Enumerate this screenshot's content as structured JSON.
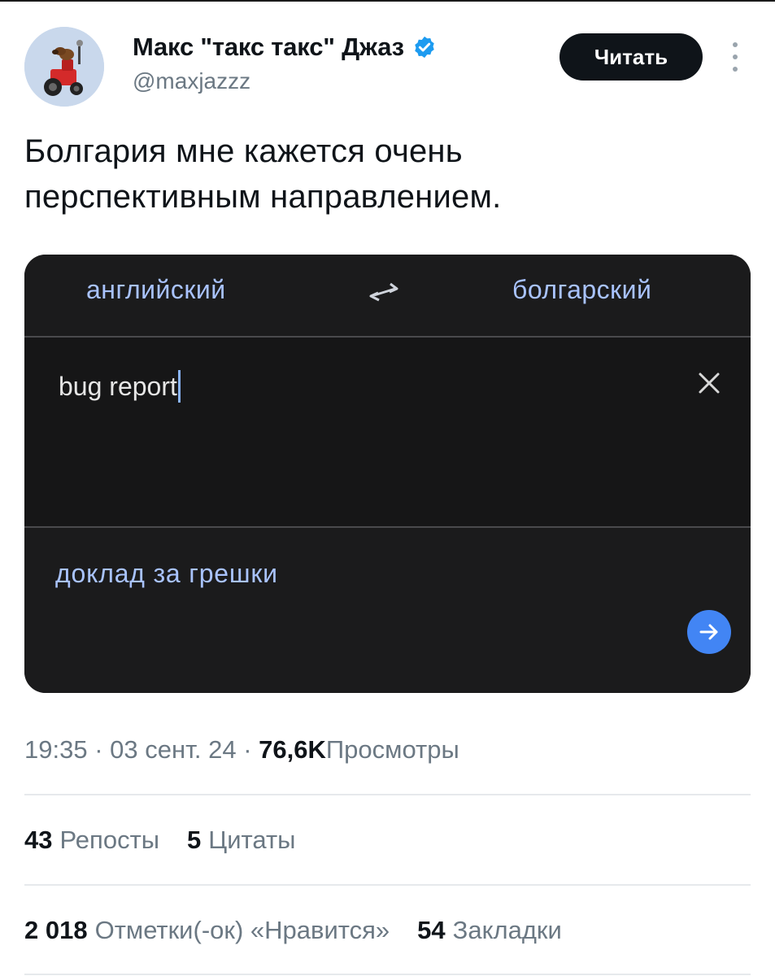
{
  "header": {
    "display_name": "Макс \"такс такс\" Джаз",
    "handle": "@maxjazzz",
    "follow_label": "Читать",
    "icons": {
      "verified": "verified-badge-icon",
      "more": "more-vertical-icon",
      "avatar": "avatar-dachshund-tractor"
    }
  },
  "tweet": {
    "text_line1": "Болгария мне кажется очень",
    "text_line2": "перспективным направлением."
  },
  "translator": {
    "source_language": "английский",
    "target_language": "болгарский",
    "source_text": "bug report",
    "translated_text": "доклад за грешки",
    "icons": {
      "swap": "swap-languages-icon",
      "clear": "close-icon",
      "go": "arrow-right-icon"
    },
    "colors": {
      "background": "#1b1b1c",
      "accent": "#a9c3ff",
      "button": "#4285f4"
    }
  },
  "meta": {
    "time": "19:35",
    "sep1": "·",
    "date": "03 сент. 24",
    "sep2": "·",
    "views_count": "76,6K",
    "views_label": "Просмотры"
  },
  "stats_row1": [
    {
      "count": "43",
      "label": "Репосты"
    },
    {
      "count": "5",
      "label": "Цитаты"
    }
  ],
  "stats_row2": [
    {
      "count": "2 018",
      "label": "Отметки(-ок) «Нравится»"
    },
    {
      "count": "54",
      "label": "Закладки"
    }
  ],
  "colors": {
    "text": "#0f1419",
    "secondary": "#6b7883",
    "verified": "#1d9bf0"
  }
}
